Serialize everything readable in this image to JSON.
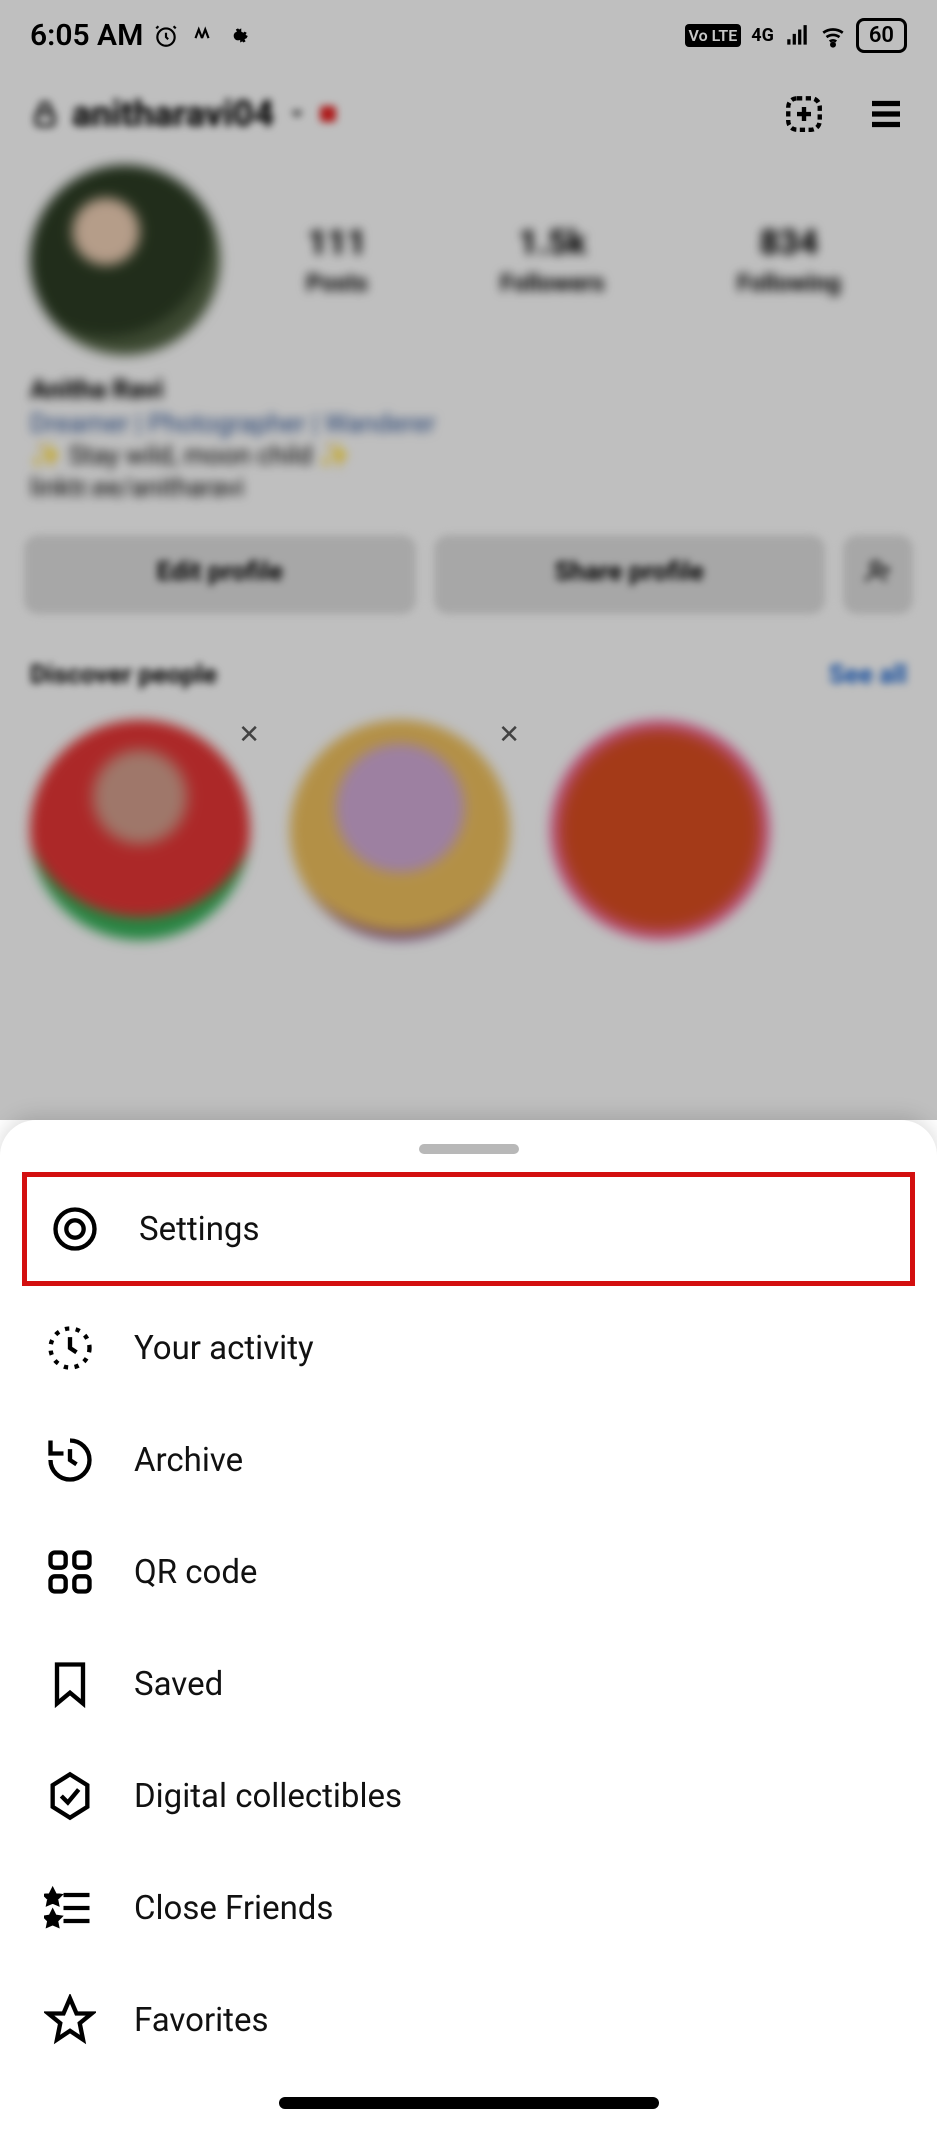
{
  "statusbar": {
    "time": "6:05 AM",
    "network": "4G",
    "volte": "Vo LTE",
    "battery": "60"
  },
  "profile": {
    "username": "anitharavi04",
    "stats": {
      "posts": {
        "value": "111",
        "label": "Posts"
      },
      "followers": {
        "value": "1.5k",
        "label": "Followers"
      },
      "following": {
        "value": "834",
        "label": "Following"
      }
    },
    "bio": {
      "name": "Anitha Ravi",
      "line1": "Dreamer | Photographer | Wanderer",
      "line2": "✨ Stay wild, moon child ✨",
      "line3": "linktr.ee/anitharavi"
    },
    "buttons": {
      "edit": "Edit profile",
      "share": "Share profile"
    },
    "discover": {
      "title": "Discover people",
      "see_all": "See all"
    }
  },
  "menu": {
    "settings": "Settings",
    "activity": "Your activity",
    "archive": "Archive",
    "qr": "QR code",
    "saved": "Saved",
    "digital": "Digital collectibles",
    "close_friends": "Close Friends",
    "favorites": "Favorites"
  }
}
